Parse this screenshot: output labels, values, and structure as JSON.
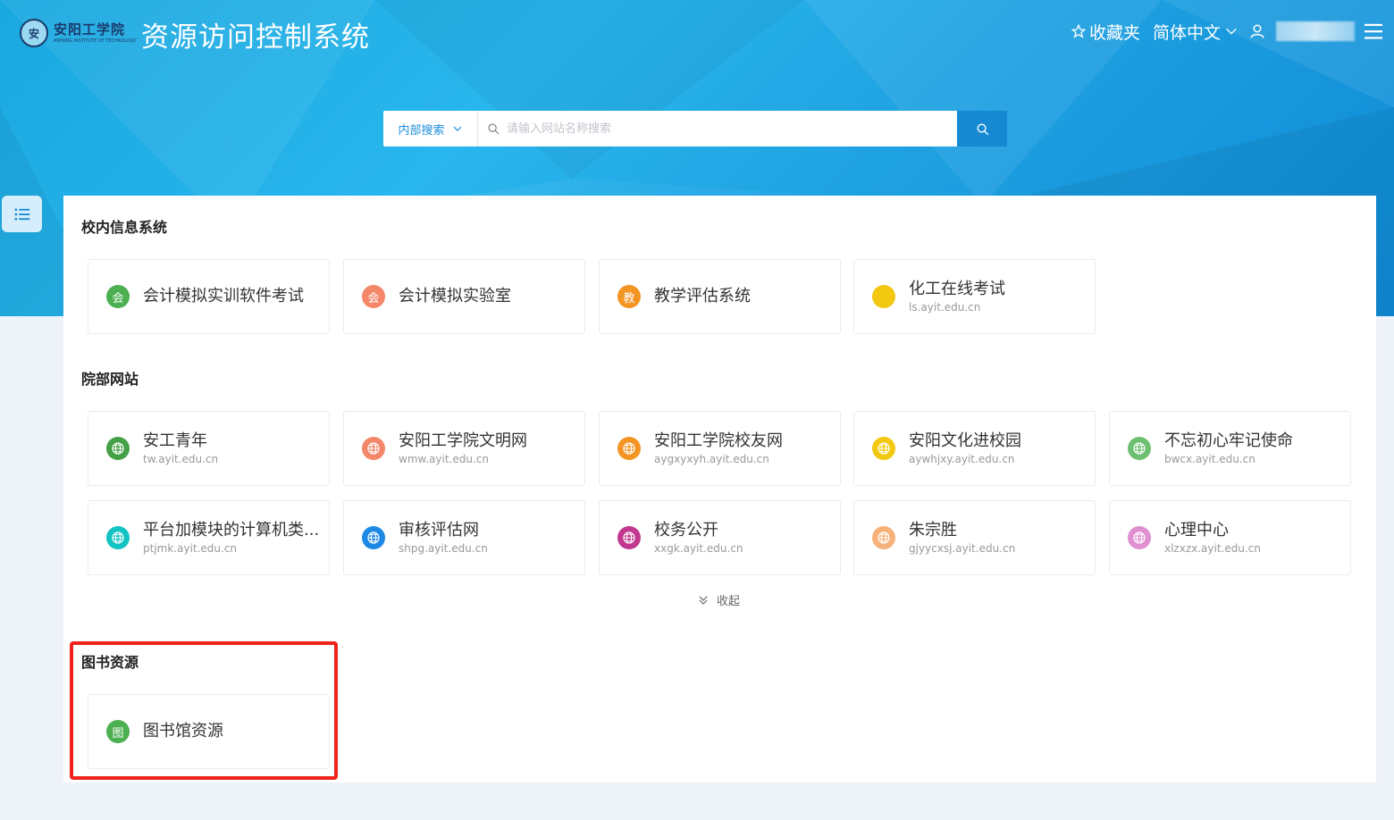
{
  "header": {
    "logo_seal": "安",
    "logo_cn": "安阳工学院",
    "logo_en": "ANYANG INSTITUTE OF TECHNOLOGY",
    "app_title": "资源访问控制系统",
    "favorites_label": "收藏夹",
    "language_label": "简体中文"
  },
  "search": {
    "scope_label": "内部搜索",
    "placeholder": "请输入网站名称搜索"
  },
  "sections": [
    {
      "title": "校内信息系统",
      "cards": [
        {
          "name": "会计模拟实训软件考试",
          "url": "",
          "icon_char": "会",
          "icon": "text-badge",
          "color": "#4caf50"
        },
        {
          "name": "会计模拟实验室",
          "url": "",
          "icon_char": "会",
          "icon": "text-badge",
          "color": "#f4876a"
        },
        {
          "name": "教学评估系统",
          "url": "",
          "icon_char": "教",
          "icon": "text-badge",
          "color": "#f39423"
        },
        {
          "name": "化工在线考试",
          "url": "ls.ayit.edu.cn",
          "icon_char": "",
          "icon": "dot",
          "color": "#f2c811"
        }
      ]
    },
    {
      "title": "院部网站",
      "cards": [
        {
          "name": "安工青年",
          "url": "tw.ayit.edu.cn",
          "icon": "globe-icon",
          "color": "#43a047"
        },
        {
          "name": "安阳工学院文明网",
          "url": "wmw.ayit.edu.cn",
          "icon": "globe-icon",
          "color": "#f4876a"
        },
        {
          "name": "安阳工学院校友网",
          "url": "aygxyxyh.ayit.edu.cn",
          "icon": "globe-icon",
          "color": "#f39423"
        },
        {
          "name": "安阳文化进校园",
          "url": "aywhjxy.ayit.edu.cn",
          "icon": "globe-icon",
          "color": "#f2c811"
        },
        {
          "name": "不忘初心牢记使命",
          "url": "bwcx.ayit.edu.cn",
          "icon": "globe-icon",
          "color": "#6cc070"
        },
        {
          "name": "平台加模块的计算机类...",
          "url": "ptjmk.ayit.edu.cn",
          "icon": "globe-icon",
          "color": "#13c2c2"
        },
        {
          "name": "审核评估网",
          "url": "shpg.ayit.edu.cn",
          "icon": "globe-icon",
          "color": "#1e88e5"
        },
        {
          "name": "校务公开",
          "url": "xxgk.ayit.edu.cn",
          "icon": "globe-icon",
          "color": "#c2378f"
        },
        {
          "name": "朱宗胜",
          "url": "gjyycxsj.ayit.edu.cn",
          "icon": "globe-icon",
          "color": "#f6b27a"
        },
        {
          "name": "心理中心",
          "url": "xlzxzx.ayit.edu.cn",
          "icon": "globe-icon",
          "color": "#e08fd0"
        }
      ],
      "collapse_label": "收起"
    },
    {
      "title": "图书资源",
      "cards": [
        {
          "name": "图书馆资源",
          "url": "",
          "icon_char": "图",
          "icon": "text-badge",
          "color": "#4caf50"
        }
      ]
    }
  ],
  "colors": {
    "primary": "#1689d2",
    "highlight": "#f0231b"
  }
}
